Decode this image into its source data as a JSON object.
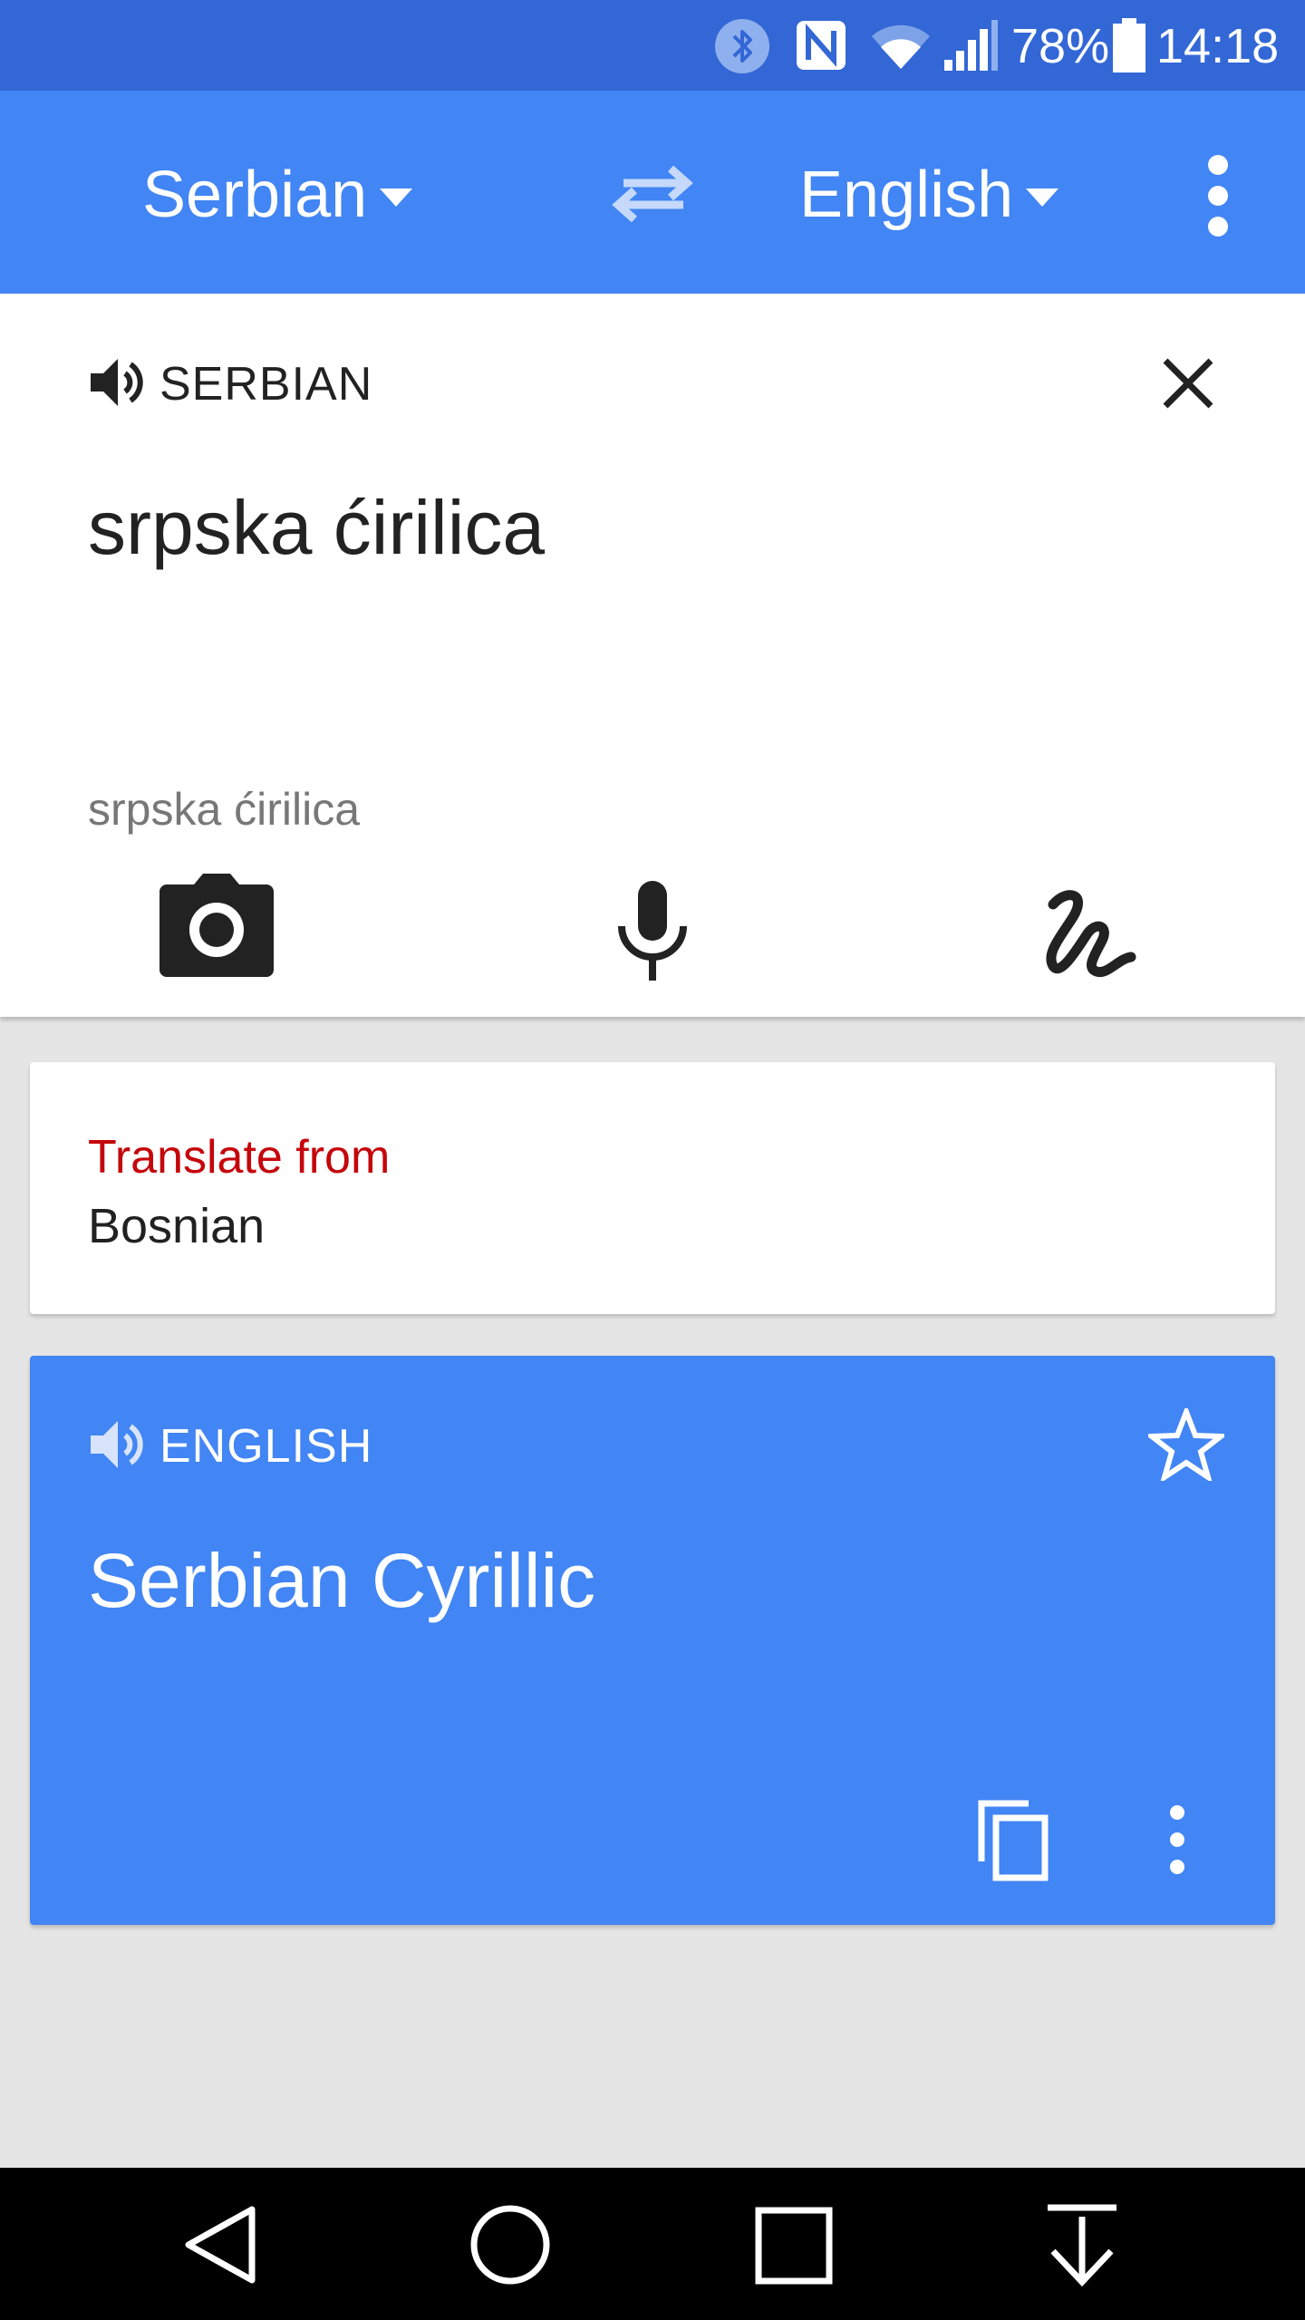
{
  "status_bar": {
    "battery": "78%",
    "time": "14:18",
    "icons": [
      "bluetooth-icon",
      "nfc-icon",
      "wifi-icon",
      "signal-icon",
      "battery-icon"
    ]
  },
  "app_bar": {
    "source_language": "Serbian",
    "target_language": "English",
    "icons": [
      "swap-languages-icon",
      "more-vert-icon"
    ]
  },
  "input": {
    "language_label": "SERBIAN",
    "text": "srpska ćirilica",
    "transliteration": "srpska ćirilica",
    "tools": [
      "camera-icon",
      "microphone-icon",
      "handwriting-icon"
    ]
  },
  "suggestion": {
    "title": "Translate from",
    "language": "Bosnian"
  },
  "result": {
    "language_label": "ENGLISH",
    "text": "Serbian Cyrillic",
    "icons": [
      "star-icon",
      "copy-icon",
      "more-vert-icon"
    ]
  },
  "nav_bar": {
    "icons": [
      "back-icon",
      "home-icon",
      "recents-icon",
      "notifications-down-icon"
    ]
  },
  "colors": {
    "status_bar": "#3367d6",
    "app_bar": "#4285f4",
    "result_card": "#4285f4",
    "suggestion_title": "#c5060b",
    "background": "#e5e5e5"
  }
}
